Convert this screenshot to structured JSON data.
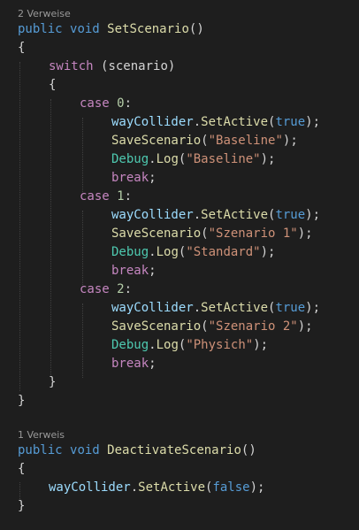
{
  "editor": {
    "colors": {
      "background": "#1e1e1e",
      "keyword": "#569cd6",
      "control": "#c586c0",
      "function": "#dcdcaa",
      "type": "#4ec9b0",
      "variable": "#9cdcfe",
      "string": "#ce9178",
      "number": "#b5cea8",
      "text": "#d4d4d4",
      "codelens": "#999999"
    },
    "setScenario": {
      "codelens": "2 Verweise",
      "decl": {
        "public": "public",
        "void": "void",
        "name": "SetScenario",
        "parens": "()"
      },
      "open_brace": "{",
      "switch": {
        "keyword": "switch",
        "arg": "(scenario)",
        "open": "{",
        "close": "}"
      },
      "cases": [
        {
          "case_kw": "case",
          "value": "0",
          "colon": ":",
          "lines": {
            "obj": "wayCollider",
            "method": "SetActive",
            "bool": "true",
            "save_fn": "SaveScenario",
            "save_arg": "\"Baseline\"",
            "debug_type": "Debug",
            "log_fn": "Log",
            "log_arg": "\"Baseline\"",
            "break": "break"
          }
        },
        {
          "case_kw": "case",
          "value": "1",
          "colon": ":",
          "lines": {
            "obj": "wayCollider",
            "method": "SetActive",
            "bool": "true",
            "save_fn": "SaveScenario",
            "save_arg": "\"Szenario 1\"",
            "debug_type": "Debug",
            "log_fn": "Log",
            "log_arg": "\"Standard\"",
            "break": "break"
          }
        },
        {
          "case_kw": "case",
          "value": "2",
          "colon": ":",
          "lines": {
            "obj": "wayCollider",
            "method": "SetActive",
            "bool": "true",
            "save_fn": "SaveScenario",
            "save_arg": "\"Szenario 2\"",
            "debug_type": "Debug",
            "log_fn": "Log",
            "log_arg": "\"Physich\"",
            "break": "break"
          }
        }
      ],
      "close_brace": "}"
    },
    "deactivateScenario": {
      "codelens": "1 Verweis",
      "decl": {
        "public": "public",
        "void": "void",
        "name": "DeactivateScenario",
        "parens": "()"
      },
      "open_brace": "{",
      "body": {
        "obj": "wayCollider",
        "method": "SetActive",
        "bool": "false"
      },
      "close_brace": "}"
    }
  }
}
